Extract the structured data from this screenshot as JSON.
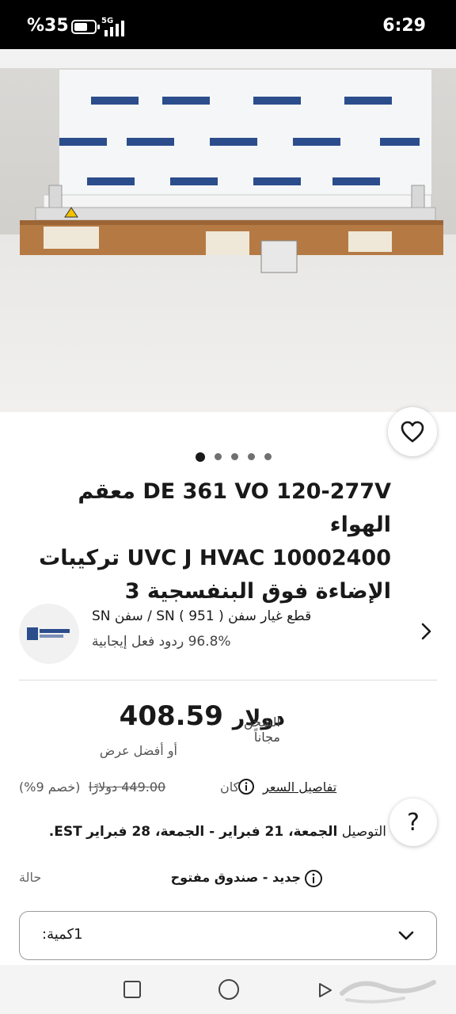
{
  "status_bar": {
    "battery_text": "%35",
    "network": "5G",
    "time": "6:29"
  },
  "hero": {
    "image_desc_icon": "product-photo-icon",
    "carousel_dots": 5,
    "active_dot": 0
  },
  "product": {
    "title_line1": "DE 361 VO 120-277V معقم الهواء",
    "title_line2": "UVC J HVAC 10002400 تركيبات",
    "title_line3": "الإضاءة فوق البنفسجية 3"
  },
  "seller": {
    "name": "SN سفن / SN قطع غيار سفن ( 951 )",
    "feedback": "96.8% ردود فعل إيجابية"
  },
  "pricing": {
    "shipping": "الشحن مجاناً",
    "currency": "دولار",
    "price": "408.59",
    "best_offer": "أو أفضل عرض",
    "details_link": "تفاصيل السعر",
    "was_label": "كان",
    "original_price": "449.00 دولارًا",
    "discount": "(خصم 9%)"
  },
  "delivery": {
    "label": "التوصيل",
    "dates": "الجمعة، 21 فبراير - الجمعة، 28 فبراير",
    "tz": "EST."
  },
  "condition": {
    "label": "حالة",
    "value": "جديد - صندوق مفتوح"
  },
  "quantity": {
    "label": "كمية:",
    "value": "1"
  },
  "help_button": "?",
  "colors": {
    "text": "#191919",
    "secondary": "#555555",
    "border": "#9a9a9a"
  }
}
